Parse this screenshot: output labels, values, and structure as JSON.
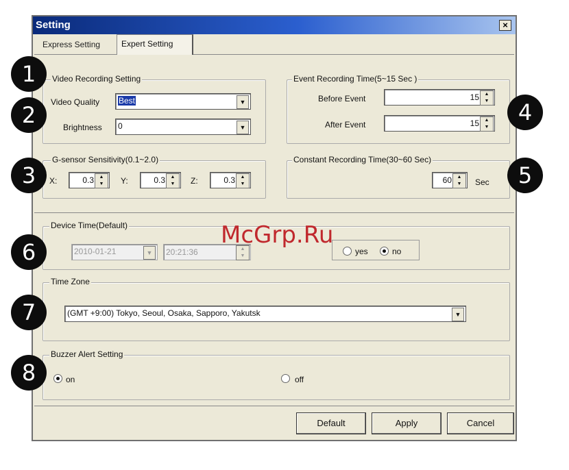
{
  "window": {
    "title": "Setting",
    "close_label": "×"
  },
  "tabs": [
    {
      "label": "Express Setting",
      "active": false
    },
    {
      "label": "Expert Setting",
      "active": true
    }
  ],
  "video_recording": {
    "group_label": "Video Recording Setting",
    "quality_label": "Video Quality",
    "quality_value": "Best",
    "brightness_label": "Brightness",
    "brightness_value": "0"
  },
  "event_recording": {
    "group_label": "Event Recording Time(5~15 Sec )",
    "before_label": "Before Event",
    "before_value": "15",
    "after_label": "After Event",
    "after_value": "15"
  },
  "gsensor": {
    "group_label": "G-sensor Sensitivity(0.1~2.0)",
    "x_label": "X:",
    "x_value": "0.3",
    "y_label": "Y:",
    "y_value": "0.3",
    "z_label": "Z:",
    "z_value": "0.3"
  },
  "constant_recording": {
    "group_label": "Constant Recording Time(30~60 Sec)",
    "value": "60",
    "unit": "Sec"
  },
  "device_time": {
    "group_label": "Device Time(Default)",
    "date_value": "2010-01-21",
    "time_value": "20:21:36",
    "yes_label": "yes",
    "no_label": "no",
    "selected": "no"
  },
  "time_zone": {
    "group_label": "Time Zone",
    "value": "(GMT +9:00) Tokyo, Seoul, Osaka, Sapporo, Yakutsk"
  },
  "buzzer": {
    "group_label": "Buzzer Alert Setting",
    "on_label": "on",
    "off_label": "off",
    "selected": "on"
  },
  "buttons": {
    "default": "Default",
    "apply": "Apply",
    "cancel": "Cancel"
  },
  "badges": [
    "1",
    "2",
    "3",
    "4",
    "5",
    "6",
    "7",
    "8"
  ],
  "watermark": "McGrp.Ru",
  "colors": {
    "title_start": "#0a2a7a",
    "title_end": "#a8c4ee",
    "dialog_bg": "#ece9d8",
    "badge": "#0d0d0d",
    "watermark": "#c0282d"
  }
}
